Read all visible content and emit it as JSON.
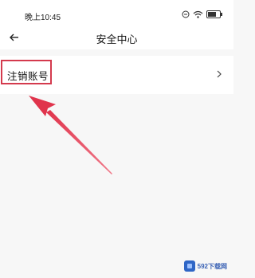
{
  "status_bar": {
    "time": "晚上10:45",
    "icons": [
      "dnd-icon",
      "wifi-icon",
      "battery-icon"
    ]
  },
  "nav": {
    "title": "安全中心",
    "back_icon": "arrow-left-icon"
  },
  "list": {
    "items": [
      {
        "label": "注销账号",
        "icon": "chevron-right-icon"
      }
    ]
  },
  "annotation": {
    "color": "#d43a4d"
  },
  "watermark": {
    "text": "592下载网"
  }
}
